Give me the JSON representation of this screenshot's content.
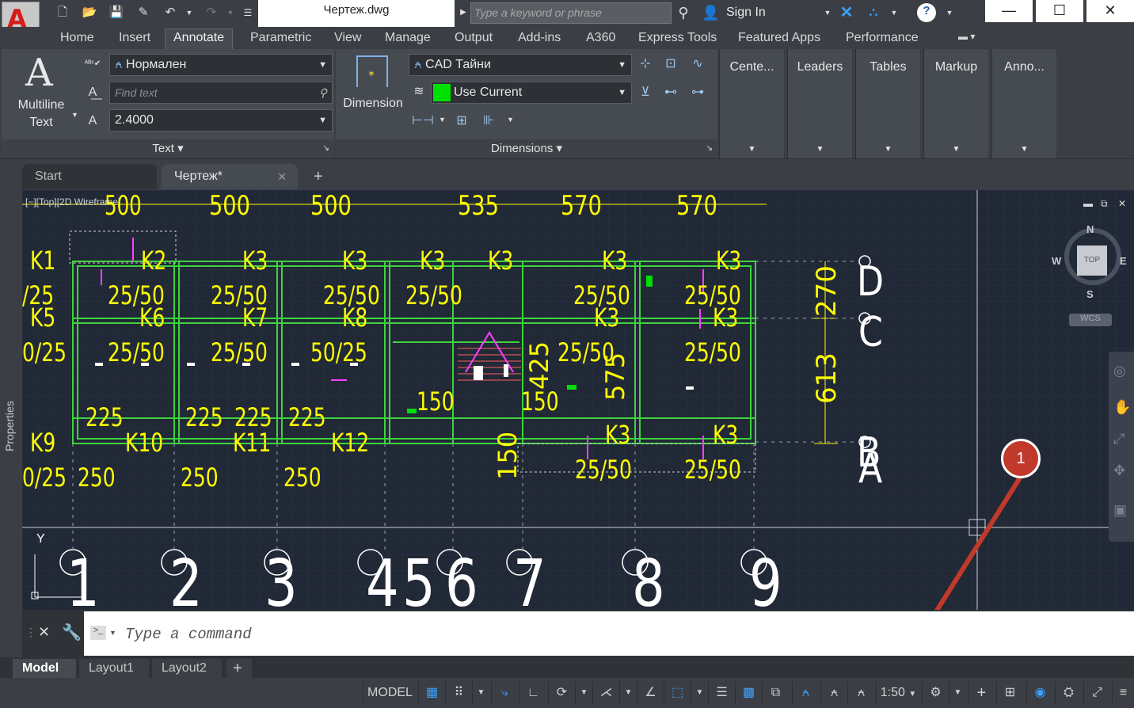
{
  "title_bar": {
    "document_title": "Чертеж.dwg",
    "search_placeholder": "Type a keyword or phrase",
    "sign_in_label": "Sign In"
  },
  "menu_tabs": [
    "Home",
    "Insert",
    "Annotate",
    "Parametric",
    "View",
    "Manage",
    "Output",
    "Add-ins",
    "A360",
    "Express Tools",
    "Featured Apps",
    "Performance"
  ],
  "active_tab": "Annotate",
  "ribbon": {
    "text_panel": {
      "big_button_label_1": "Multiline",
      "big_button_label_2": "Text",
      "text_style": "Нормален",
      "find_placeholder": "Find text",
      "text_height": "2.4000",
      "panel_title": "Text"
    },
    "dimension_panel": {
      "big_button_label": "Dimension",
      "dim_style": "CAD Тайни",
      "layer": "Use Current",
      "panel_title": "Dimensions"
    },
    "side_panels": [
      "Cente...",
      "Leaders",
      "Tables",
      "Markup",
      "Anno..."
    ]
  },
  "document_tabs": {
    "start": "Start",
    "drawing": "Чертеж*"
  },
  "viewport": {
    "view_label": "[−][Top][2D Wireframe]",
    "compass": {
      "n": "N",
      "s": "S",
      "e": "E",
      "w": "W",
      "top": "TOP"
    },
    "wcs_label": "WCS",
    "y_axis_label": "Y",
    "grid_numbers": [
      "1",
      "2",
      "3",
      "4",
      "5",
      "6",
      "7",
      "8",
      "9"
    ],
    "grid_letters": [
      "D",
      "C",
      "B",
      "A"
    ],
    "top_dims": [
      "500",
      "500",
      "500",
      "535",
      "570",
      "570"
    ],
    "labels": [
      {
        "t": "K1"
      },
      {
        "t": "K2"
      },
      {
        "t": "K3"
      },
      {
        "t": "K3"
      },
      {
        "t": "K3"
      },
      {
        "t": "K3"
      },
      {
        "t": "K3"
      },
      {
        "t": "K3"
      },
      {
        "t": "/25"
      },
      {
        "t": "25/50"
      },
      {
        "t": "25/50"
      },
      {
        "t": "25/50"
      },
      {
        "t": "25/50"
      },
      {
        "t": "25/50"
      },
      {
        "t": "25/50"
      },
      {
        "t": "K5"
      },
      {
        "t": "K6"
      },
      {
        "t": "K7"
      },
      {
        "t": "K8"
      },
      {
        "t": "K3"
      },
      {
        "t": "K3"
      },
      {
        "t": "0/25"
      },
      {
        "t": "25/50"
      },
      {
        "t": "25/50"
      },
      {
        "t": "50/25"
      },
      {
        "t": "25/50"
      },
      {
        "t": "25/50"
      },
      {
        "t": "225"
      },
      {
        "t": "225"
      },
      {
        "t": "225"
      },
      {
        "t": "225"
      },
      {
        "t": "150"
      },
      {
        "t": "150"
      },
      {
        "t": "K9"
      },
      {
        "t": "K10"
      },
      {
        "t": "K11"
      },
      {
        "t": "K12"
      },
      {
        "t": "K3"
      },
      {
        "t": "K3"
      },
      {
        "t": "0/25"
      },
      {
        "t": "250"
      },
      {
        "t": "250"
      },
      {
        "t": "250"
      },
      {
        "t": "25/50"
      },
      {
        "t": "25/50"
      },
      {
        "t": "270"
      },
      {
        "t": "613"
      },
      {
        "t": "425"
      },
      {
        "t": "575"
      },
      {
        "t": "150"
      }
    ]
  },
  "command_line": {
    "placeholder": "Type a command"
  },
  "layout_tabs": [
    "Model",
    "Layout1",
    "Layout2"
  ],
  "status_bar": {
    "model_label": "MODEL",
    "scale": "1:50"
  },
  "callout_number": "1",
  "colors": {
    "canvas_bg": "#212836",
    "yellow": "#ffff00",
    "green": "#00ff00",
    "white": "#ffffff",
    "magenta": "#ff00ff",
    "accent_blue": "#3aa0ff",
    "callout_red": "#c0392b"
  }
}
